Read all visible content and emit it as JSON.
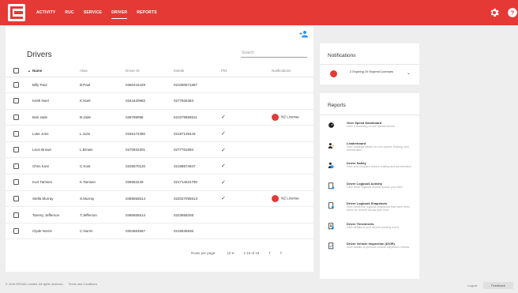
{
  "colors": {
    "brand_red": "#e53935",
    "background": "#eeeeee",
    "panel": "#ffffff"
  },
  "nav": {
    "items": [
      {
        "label": "ACTIVITY",
        "active": false
      },
      {
        "label": "RUC",
        "active": false
      },
      {
        "label": "SERVICE",
        "active": false
      },
      {
        "label": "DRIVER",
        "active": true
      },
      {
        "label": "REPORTS",
        "active": false
      }
    ],
    "icons": [
      "settings-icon",
      "help-icon"
    ]
  },
  "drivers": {
    "title": "Drivers",
    "search_placeholder": "Search",
    "columns": {
      "name": "Name",
      "alias": "Alias",
      "driver_id": "Driver ID",
      "mobile": "Mobile",
      "pin": "PIN",
      "notifications": "Notifications"
    },
    "rows": [
      {
        "name": "Billy Paul",
        "alias": "B.Paul",
        "driver_id": "0360415429",
        "mobile": "021060571587",
        "pin": false,
        "notification": ""
      },
      {
        "name": "Keith Noel",
        "alias": "K.Noel",
        "driver_id": "0344420982",
        "mobile": "0277925383",
        "pin": false,
        "notification": ""
      },
      {
        "name": "Bob Jade",
        "alias": "B.Jade",
        "driver_id": "036789096",
        "mobile": "021079556511",
        "pin": true,
        "notification": "NZ License"
      },
      {
        "name": "Luke Joris",
        "alias": "L.Joris",
        "driver_id": "0345172380",
        "mobile": "02187129443",
        "pin": true,
        "notification": ""
      },
      {
        "name": "Leon Brown",
        "alias": "L.Brown",
        "driver_id": "0270932301",
        "mobile": "0277761894",
        "pin": true,
        "notification": ""
      },
      {
        "name": "Chris Kust",
        "alias": "C.Kust",
        "driver_id": "0225670120",
        "mobile": "02188574947",
        "pin": true,
        "notification": ""
      },
      {
        "name": "Kurt Tamsen",
        "alias": "K.Tamsen",
        "driver_id": "028663249",
        "mobile": "021714531790",
        "pin": true,
        "notification": ""
      },
      {
        "name": "Stella Murray",
        "alias": "S.Murray",
        "driver_id": "0485655514",
        "mobile": "022027095513",
        "pin": true,
        "notification": "NZ License"
      },
      {
        "name": "Tammy Jefferson",
        "alias": "T.Jefferson",
        "driver_id": "0485655514",
        "mobile": "0223858208",
        "pin": false,
        "notification": ""
      },
      {
        "name": "Clyde Norris",
        "alias": "C.Norris",
        "driver_id": "0304564657",
        "mobile": "0218536836",
        "pin": false,
        "notification": ""
      }
    ],
    "pagination": {
      "rows_per_page_label": "Rows per page:",
      "rows_per_page": "10",
      "range": "1-10 of 19"
    }
  },
  "notifications": {
    "title": "Notifications",
    "item": "2 Expiring Or Expired Licenses"
  },
  "reports": {
    "title": "Reports",
    "items": [
      {
        "icon": "speedometer-icon",
        "title": "Over Speed Dashboard",
        "desc": "View a summary of over speed events"
      },
      {
        "icon": "leaderboard-icon",
        "title": "Leaderboard",
        "desc": "View rankings based on over speed, braking, and acceleration"
      },
      {
        "icon": "driver-safety-icon",
        "title": "Driver Safety",
        "desc": "View and compare drivers braking and acceleration"
      },
      {
        "icon": "logbook-activity-icon",
        "title": "Driver Logbook Activity",
        "desc": "View driver logbook activity across your fleet"
      },
      {
        "icon": "logbook-snapshots-icon",
        "title": "Driver Logbook Snapshots",
        "desc": "View electronic logbook snapshots that have been taken for drivers across your fleet"
      },
      {
        "icon": "timesheets-icon",
        "title": "Driver Timesheets",
        "desc": "View details of your drivers working hours"
      },
      {
        "icon": "inspection-icon",
        "title": "Driver Vehicle Inspection (DVIR)",
        "desc": "View details of previous vehicle inspection checks"
      }
    ]
  },
  "footer": {
    "copyright": "© 2016 EROAD Limited. All rights reserved.",
    "terms": "Terms and Conditions",
    "logout": "Logout",
    "feedback": "Feedback"
  }
}
